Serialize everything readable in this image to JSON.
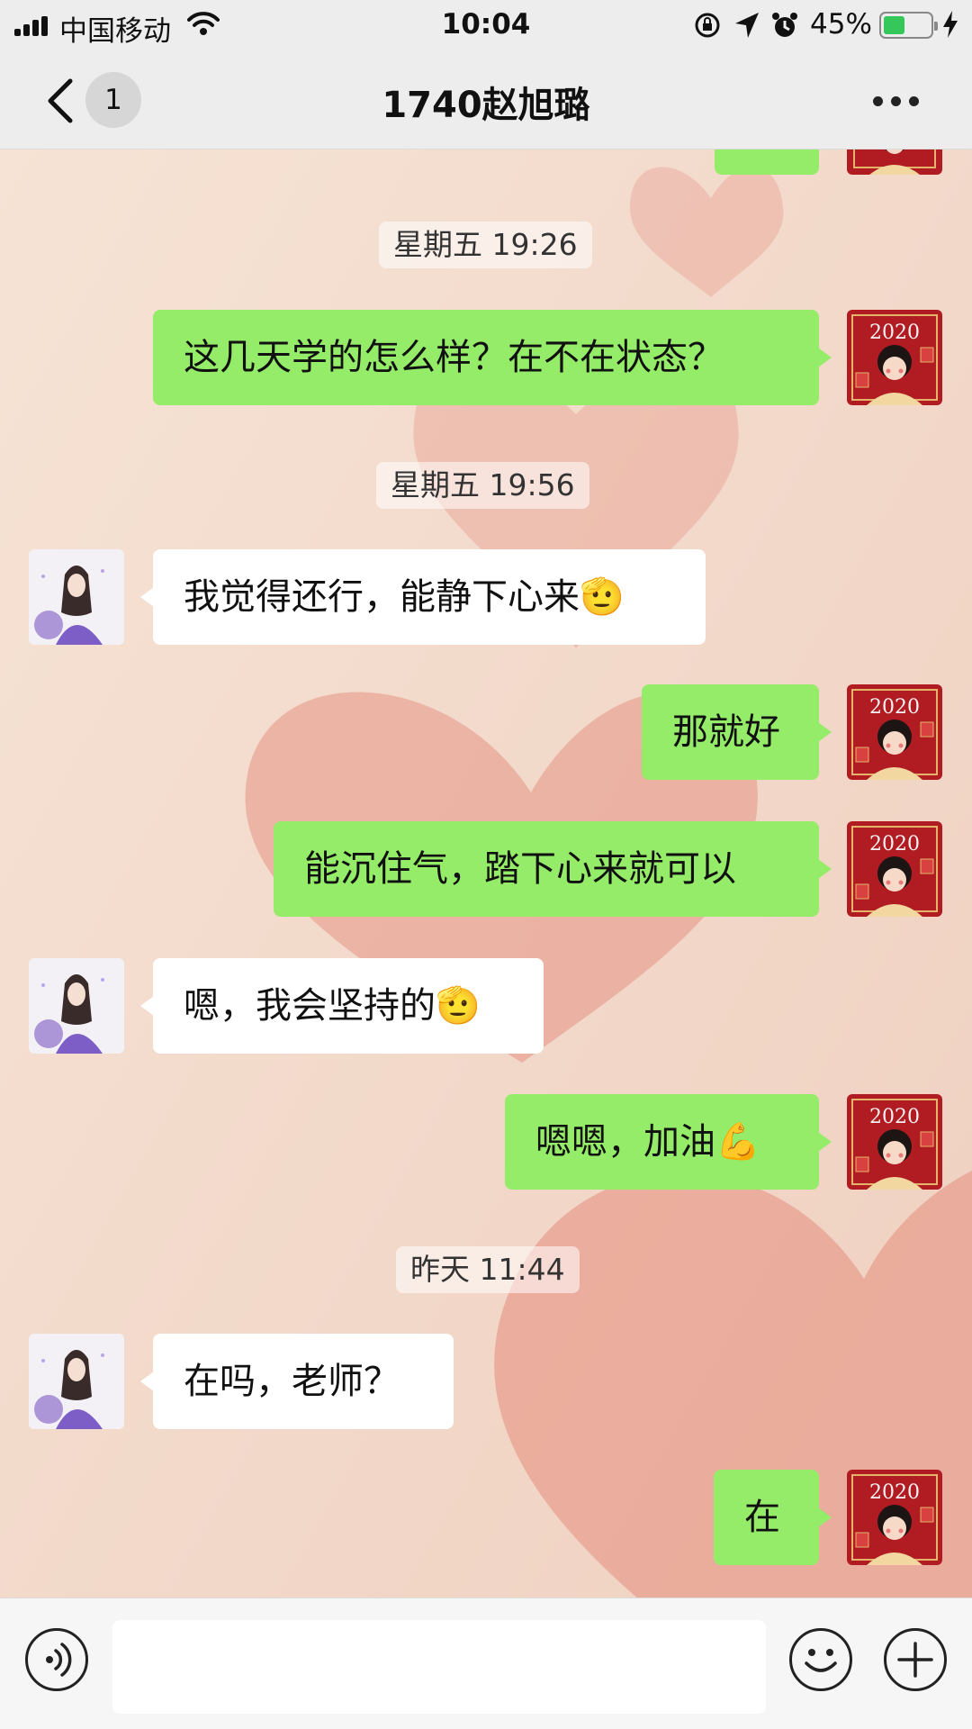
{
  "status_bar": {
    "carrier": "中国移动",
    "time": "10:04",
    "battery_percent": "45%",
    "battery_level": 0.45,
    "icons": [
      "signal-icon",
      "wifi-icon",
      "orientation-lock-icon",
      "location-icon",
      "alarm-icon",
      "battery-icon",
      "charging-icon"
    ]
  },
  "nav": {
    "back_badge": "1",
    "title": "1740赵旭璐",
    "more_icon": "more-icon"
  },
  "chat": {
    "messages": [
      {
        "type": "time",
        "text": "星期五 19:26"
      },
      {
        "type": "message",
        "side": "right",
        "text": "这几天学的怎么样？在不在状态？"
      },
      {
        "type": "time",
        "text": "星期五 19:56"
      },
      {
        "type": "message",
        "side": "left",
        "text": "我觉得还行，能静下心来",
        "emoji": "🫡"
      },
      {
        "type": "message",
        "side": "right",
        "text": "那就好"
      },
      {
        "type": "message",
        "side": "right",
        "text": "能沉住气，踏下心来就可以"
      },
      {
        "type": "message",
        "side": "left",
        "text": "嗯，我会坚持的",
        "emoji": "🫡"
      },
      {
        "type": "message",
        "side": "right",
        "text": "嗯嗯，加油",
        "emoji": "💪"
      },
      {
        "type": "time",
        "text": "昨天 11:44"
      },
      {
        "type": "message",
        "side": "left",
        "text": "在吗，老师？"
      },
      {
        "type": "message",
        "side": "right",
        "text": "在"
      }
    ],
    "my_avatar_text": "2020"
  },
  "input_bar": {
    "voice_icon": "voice-icon",
    "message_value": "",
    "emoji_icon": "emoji-icon",
    "add_icon": "add-icon"
  },
  "colors": {
    "sent_bubble": "#95ec69",
    "received_bubble": "#ffffff",
    "bar_background": "#ededed",
    "wallpaper": "#f3dccd",
    "heart": "#e79a8b",
    "avatar_red": "#b01c22"
  }
}
